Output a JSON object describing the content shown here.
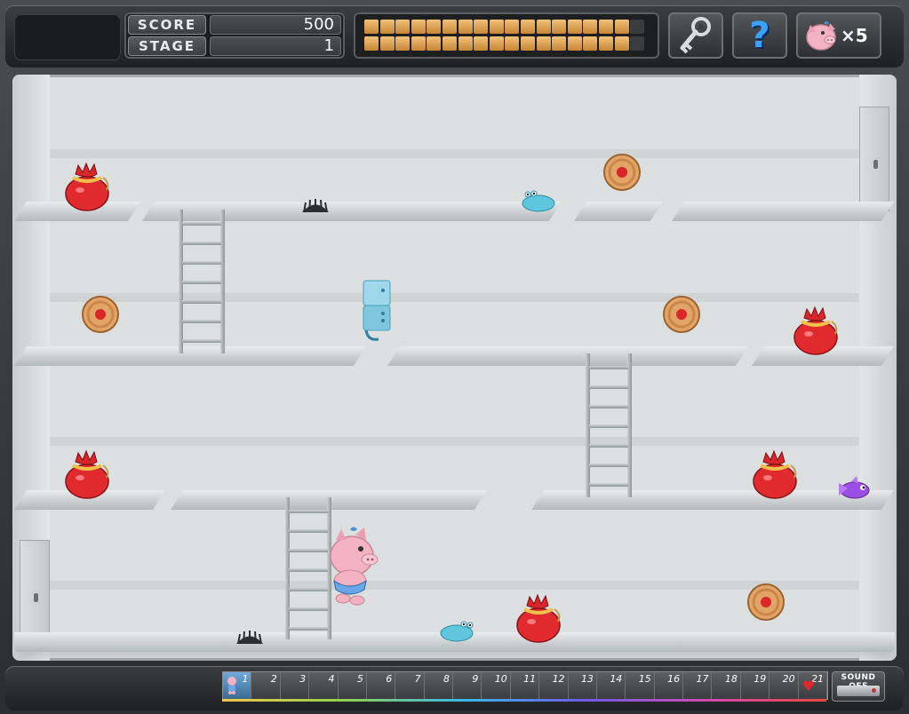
{
  "hud": {
    "score_label": "SCORE",
    "score_value": "500",
    "stage_label": "STAGE",
    "stage_value": "1",
    "energy": {
      "filled": 17,
      "total": 18
    },
    "lives_prefix": "×",
    "lives_count": "5"
  },
  "icons": {
    "key": "key-icon",
    "help": "question-mark-icon",
    "lives": "pig-face-icon",
    "bag": "money-bag-icon",
    "cookie": "cookie-icon",
    "slug": "slug-enemy",
    "fish": "purple-fish-enemy",
    "trap": "spike-trap",
    "freezer": "ice-block",
    "heart": "heart-icon"
  },
  "bottom_bar": {
    "stages": [
      "1",
      "2",
      "3",
      "4",
      "5",
      "6",
      "7",
      "8",
      "9",
      "10",
      "11",
      "12",
      "13",
      "14",
      "15",
      "16",
      "17",
      "18",
      "19",
      "20",
      "21"
    ],
    "current_stage": "1",
    "sound_label": "SOUND OFF"
  },
  "colors": {
    "energy_fill": "#e0a456",
    "help_blue": "#3aa3ff",
    "bag_red": "#d9262b",
    "slug_cyan": "#5fc6dd",
    "fish_purple": "#9b4ee3",
    "pig_pink": "#f4b3c2"
  }
}
